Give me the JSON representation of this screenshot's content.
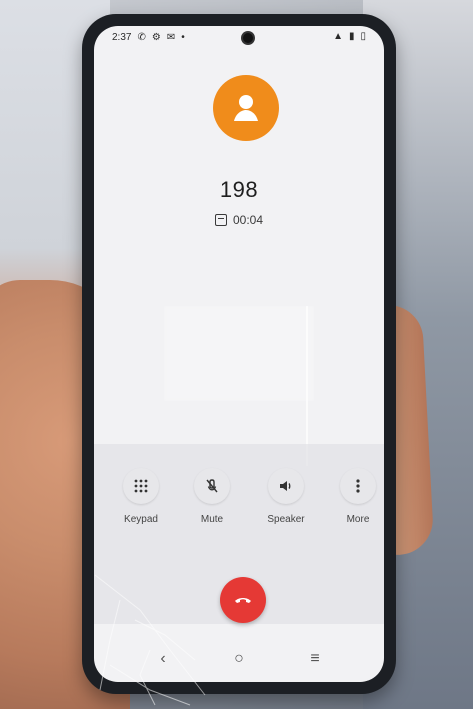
{
  "status_bar": {
    "time": "2:37"
  },
  "call": {
    "caller_number": "198",
    "duration": "00:04"
  },
  "controls": [
    {
      "label": "Keypad",
      "icon": "keypad-icon"
    },
    {
      "label": "Mute",
      "icon": "mic-off-icon"
    },
    {
      "label": "Speaker",
      "icon": "speaker-icon"
    },
    {
      "label": "More",
      "icon": "more-vert-icon"
    }
  ],
  "actions": {
    "end_call_icon": "phone-hangup-icon"
  },
  "colors": {
    "avatar_bg": "#f08c1b",
    "end_call_bg": "#e53935",
    "screen_bg": "#f2f2f4"
  }
}
